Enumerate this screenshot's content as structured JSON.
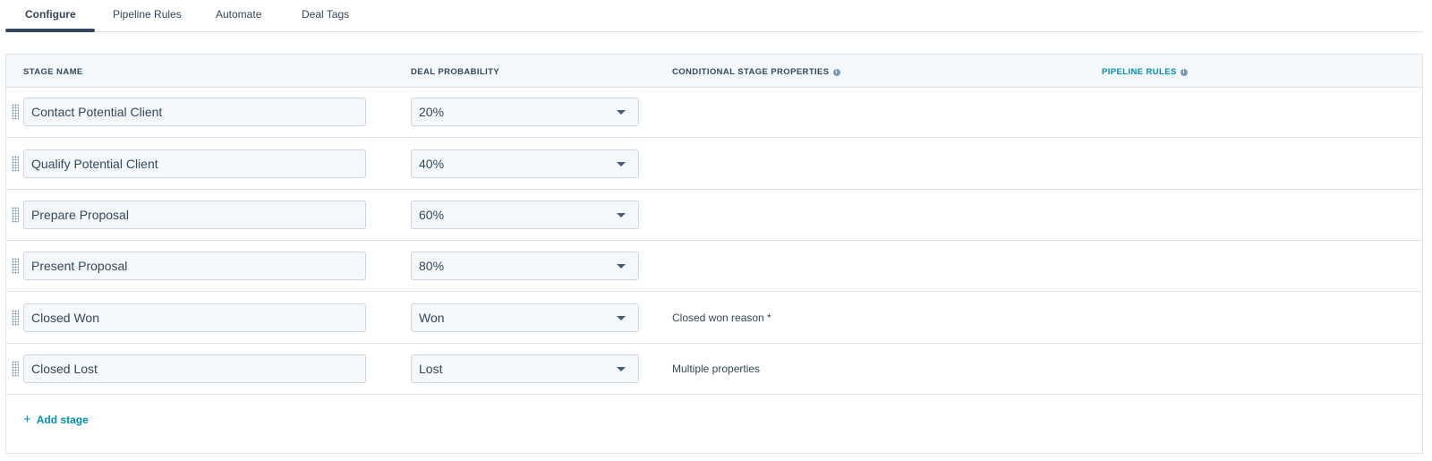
{
  "tabs": [
    {
      "label": "Configure",
      "active": true
    },
    {
      "label": "Pipeline Rules",
      "active": false
    },
    {
      "label": "Automate",
      "active": false
    },
    {
      "label": "Deal Tags",
      "active": false
    }
  ],
  "table": {
    "headers": {
      "stage_name": "STAGE NAME",
      "deal_probability": "DEAL PROBABILITY",
      "conditional_props": "CONDITIONAL STAGE PROPERTIES",
      "pipeline_rules": "PIPELINE RULES"
    },
    "rows": [
      {
        "stage": "Contact Potential Client",
        "probability": "20%",
        "conditional": ""
      },
      {
        "stage": "Qualify Potential Client",
        "probability": "40%",
        "conditional": ""
      },
      {
        "stage": "Prepare Proposal",
        "probability": "60%",
        "conditional": ""
      },
      {
        "stage": "Present Proposal",
        "probability": "80%",
        "conditional": ""
      },
      {
        "stage": "Closed Won",
        "probability": "Won",
        "conditional": "Closed won reason *"
      },
      {
        "stage": "Closed Lost",
        "probability": "Lost",
        "conditional": "Multiple properties"
      }
    ],
    "add_stage_label": "Add stage"
  },
  "icons": {
    "info": "info-icon",
    "drag": "drag-handle-icon",
    "caret": "caret-down-icon",
    "plus": "plus-icon"
  },
  "colors": {
    "text": "#33475b",
    "link": "#0091ae",
    "border": "#dfe3eb",
    "header_bg": "#f5f8fa",
    "input_bg": "#f5f8fa"
  }
}
